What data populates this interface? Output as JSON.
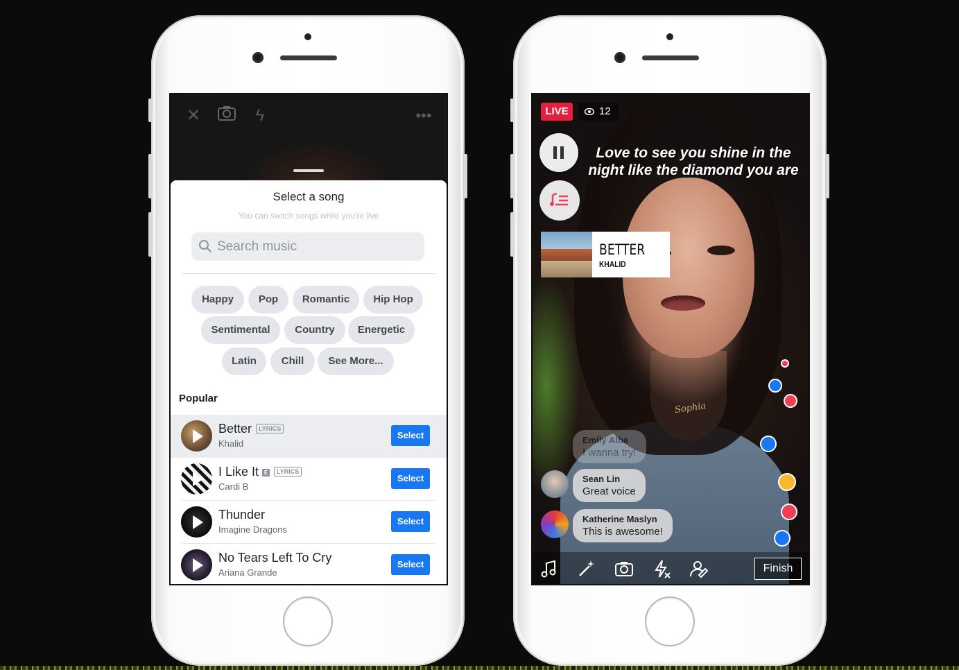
{
  "song_picker": {
    "title": "Select a song",
    "subtitle": "You can switch songs while you're live",
    "search_placeholder": "Search music",
    "genres": [
      "Happy",
      "Pop",
      "Romantic",
      "Hip Hop",
      "Sentimental",
      "Country",
      "Energetic",
      "Latin",
      "Chill",
      "See More..."
    ],
    "section_label": "Popular",
    "songs": [
      {
        "title": "Better",
        "artist": "Khalid",
        "badge": "LYRICS",
        "explicit": "",
        "button": "Select",
        "selected": true
      },
      {
        "title": "I Like It",
        "artist": "Cardi B",
        "badge": "LYRICS",
        "explicit": "E",
        "button": "Select",
        "selected": false
      },
      {
        "title": "Thunder",
        "artist": "Imagine Dragons",
        "badge": "",
        "explicit": "",
        "button": "Select",
        "selected": false
      },
      {
        "title": "No Tears Left To Cry",
        "artist": "Ariana Grande",
        "badge": "",
        "explicit": "",
        "button": "Select",
        "selected": false
      }
    ]
  },
  "live": {
    "badge": "LIVE",
    "viewer_count": "12",
    "lyric_line": "Love to see you shine in the night like the diamond you are",
    "now_playing": {
      "title": "BETTER",
      "artist": "KHALID"
    },
    "necklace_text": "Sophia",
    "comments": [
      {
        "name": "Emily Alba",
        "text": "I wanna try!"
      },
      {
        "name": "Sean Lin",
        "text": "Great voice"
      },
      {
        "name": "Katherine Maslyn",
        "text": "This is awesome!"
      }
    ],
    "finish_label": "Finish"
  },
  "colors": {
    "accent": "#1877f2",
    "live_red": "#e41e3f",
    "chip_bg": "#e4e6eb"
  },
  "icons": {
    "left_top": [
      "close-icon",
      "camera-flip-icon",
      "flash-off-icon",
      "more-icon"
    ],
    "bottom_bar": [
      "music-note-icon",
      "magic-wand-icon",
      "camera-flip-icon",
      "flash-off-icon",
      "add-guest-icon"
    ]
  }
}
